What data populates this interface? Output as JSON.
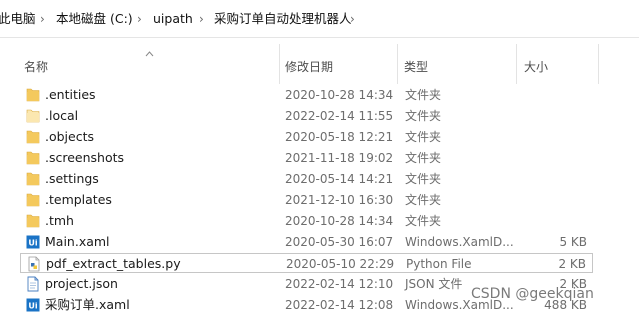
{
  "breadcrumb": {
    "segments": [
      "此电脑",
      "本地磁盘 (C:)",
      "uipath",
      "采购订单自动处理机器人"
    ],
    "separator": "›"
  },
  "columns": {
    "name": "名称",
    "date": "修改日期",
    "type": "类型",
    "size": "大小"
  },
  "files": [
    {
      "name": ".entities",
      "date": "2020-10-28 14:34",
      "type": "文件夹",
      "size": "",
      "icon": "folder-icon"
    },
    {
      "name": ".local",
      "date": "2022-02-14 11:55",
      "type": "文件夹",
      "size": "",
      "icon": "folder-light-icon"
    },
    {
      "name": ".objects",
      "date": "2020-05-18 12:21",
      "type": "文件夹",
      "size": "",
      "icon": "folder-icon"
    },
    {
      "name": ".screenshots",
      "date": "2021-11-18 19:02",
      "type": "文件夹",
      "size": "",
      "icon": "folder-icon"
    },
    {
      "name": ".settings",
      "date": "2020-05-14 14:21",
      "type": "文件夹",
      "size": "",
      "icon": "folder-icon"
    },
    {
      "name": ".templates",
      "date": "2021-12-10 16:30",
      "type": "文件夹",
      "size": "",
      "icon": "folder-icon"
    },
    {
      "name": ".tmh",
      "date": "2020-10-28 14:34",
      "type": "文件夹",
      "size": "",
      "icon": "folder-icon"
    },
    {
      "name": "Main.xaml",
      "date": "2020-05-30 16:07",
      "type": "Windows.XamlD...",
      "size": "5 KB",
      "icon": "uipath-xaml-icon"
    },
    {
      "name": "pdf_extract_tables.py",
      "date": "2020-05-10 22:29",
      "type": "Python File",
      "size": "2 KB",
      "icon": "python-file-icon"
    },
    {
      "name": "project.json",
      "date": "2022-02-14 12:10",
      "type": "JSON 文件",
      "size": "2 KB",
      "icon": "json-file-icon"
    },
    {
      "name": "采购订单.xaml",
      "date": "2022-02-14 12:08",
      "type": "Windows.XamlD...",
      "size": "488 KB",
      "icon": "uipath-xaml-icon"
    }
  ],
  "selected_index": 8,
  "watermark": "CSDN @geekqian",
  "colors": {
    "folder": "#f4c95d",
    "folder_light": "#fbe7b0",
    "uipath": "#1a73c6",
    "selection_border": "#c6c6c6"
  }
}
